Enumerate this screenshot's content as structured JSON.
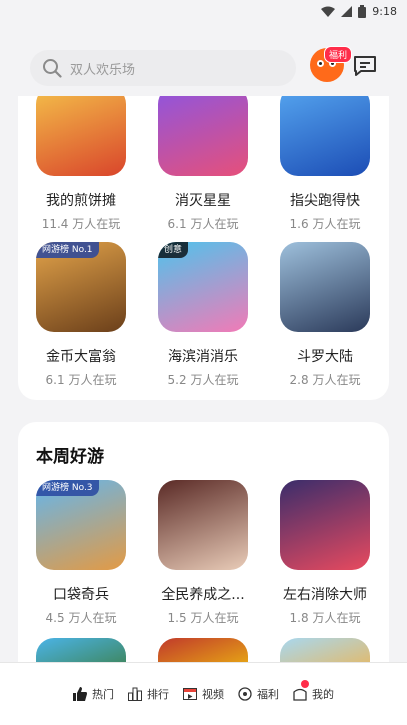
{
  "status": {
    "time": "9:18"
  },
  "header": {
    "search_placeholder": "双人欢乐场",
    "welfare_badge": "福利"
  },
  "section1": {
    "games": [
      {
        "name": "我的煎饼摊",
        "players": "11.4 万人在玩",
        "icon_colors": [
          "#f2b233",
          "#c94b2e"
        ],
        "tag": ""
      },
      {
        "name": "消灭星星",
        "players": "6.1 万人在玩",
        "icon_colors": [
          "#7a4bd8",
          "#e84f7a"
        ],
        "tag": ""
      },
      {
        "name": "指尖跑得快",
        "players": "1.6 万人在玩",
        "icon_colors": [
          "#3c8ce6",
          "#1a4fb6"
        ],
        "tag": ""
      },
      {
        "name": "金币大富翁",
        "players": "6.1 万人在玩",
        "icon_colors": [
          "#d08b35",
          "#6b3f1a"
        ],
        "tag": "网游榜 No.1"
      },
      {
        "name": "海滨消消乐",
        "players": "5.2 万人在玩",
        "icon_colors": [
          "#4fbde8",
          "#f07ab0"
        ],
        "tag": "创意"
      },
      {
        "name": "斗罗大陆",
        "players": "2.8 万人在玩",
        "icon_colors": [
          "#7fa6c7",
          "#2b3a5a"
        ],
        "tag": ""
      }
    ]
  },
  "section2": {
    "title": "本周好游",
    "games": [
      {
        "name": "口袋奇兵",
        "players": "4.5 万人在玩",
        "icon_colors": [
          "#5fb0ea",
          "#e7a552"
        ],
        "tag": "网游榜 No.3"
      },
      {
        "name": "全民养成之...",
        "players": "1.5 万人在玩",
        "icon_colors": [
          "#6b2f2a",
          "#e8c9b5"
        ],
        "tag": ""
      },
      {
        "name": "左右消除大师",
        "players": "1.8 万人在玩",
        "icon_colors": [
          "#3a2d6b",
          "#e84a5f"
        ],
        "tag": ""
      }
    ]
  },
  "bottom_nav": [
    {
      "label": "热门",
      "icon": "thumbs-up-icon"
    },
    {
      "label": "排行",
      "icon": "ranking-icon"
    },
    {
      "label": "视频",
      "icon": "video-icon"
    },
    {
      "label": "福利",
      "icon": "gift-icon"
    },
    {
      "label": "我的",
      "icon": "profile-icon"
    }
  ]
}
